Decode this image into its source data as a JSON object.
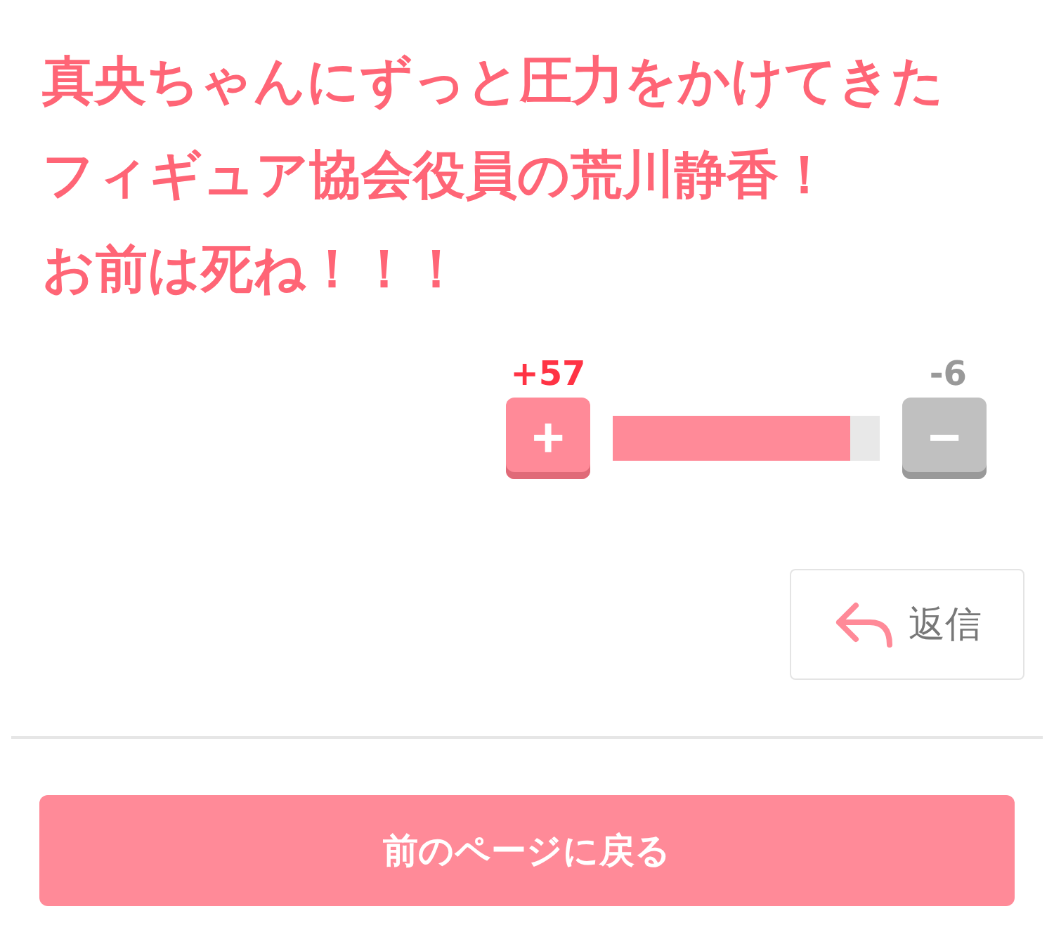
{
  "message_lines": [
    "真央ちゃんにずっと圧力をかけてきた",
    "フィギュア協会役員の荒川静香！",
    "お前は死ね！！！"
  ],
  "vote": {
    "up_count": "+57",
    "down_count": "-6",
    "up_label": "+",
    "down_label": "−",
    "level": 0.89
  },
  "reply_button": {
    "label": "返信"
  },
  "back_button": {
    "label": "前のページに戻る"
  }
}
